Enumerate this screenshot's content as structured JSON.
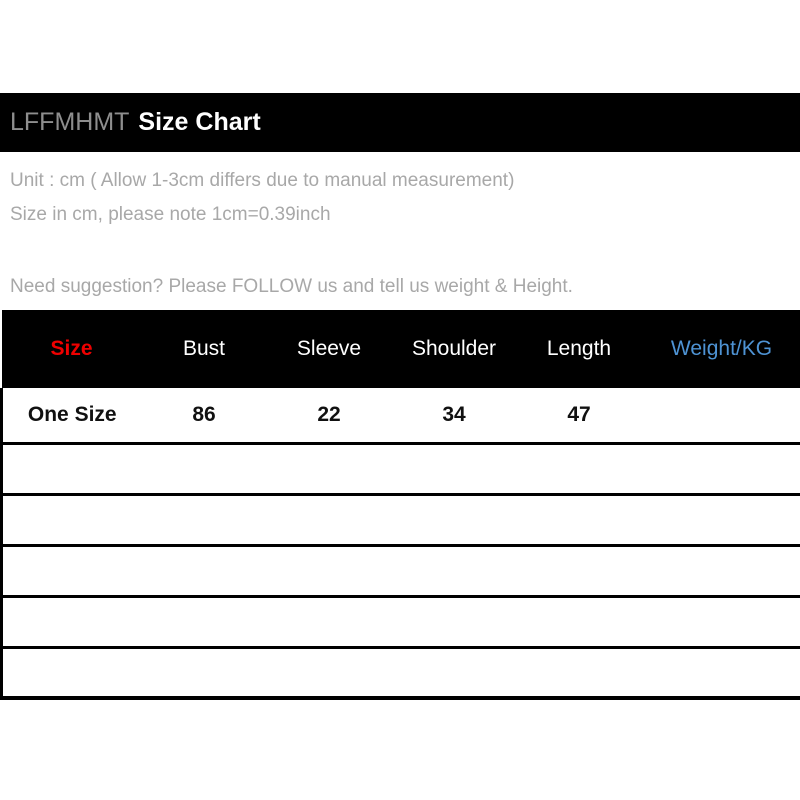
{
  "header": {
    "brand": "LFFMHMT",
    "title": "Size Chart"
  },
  "notes": {
    "line1": "Unit : cm ( Allow 1-3cm differs due to manual measurement)",
    "line2": "Size in cm, please note 1cm=0.39inch",
    "line3": "Need suggestion? Please FOLLOW us and tell us weight & Height."
  },
  "colors": {
    "band_background": "#000000",
    "brand_text": "#8e8e8e",
    "title_text": "#ffffff",
    "note_text": "#a8a8a8",
    "size_header": "#ee0000",
    "weight_header": "#4e93d4",
    "header_text": "#ffffff",
    "cell_text": "#111111",
    "border": "#000000"
  },
  "table": {
    "columns": [
      {
        "label": "Size",
        "key": "size"
      },
      {
        "label": "Bust",
        "key": "bust"
      },
      {
        "label": "Sleeve",
        "key": "sleeve"
      },
      {
        "label": "Shoulder",
        "key": "shoulder"
      },
      {
        "label": "Length",
        "key": "length"
      },
      {
        "label": "Weight/KG",
        "key": "weight"
      }
    ],
    "rows": [
      {
        "size": "One Size",
        "bust": "86",
        "sleeve": "22",
        "shoulder": "34",
        "length": "47",
        "weight": ""
      }
    ],
    "empty_row_count": 5
  }
}
